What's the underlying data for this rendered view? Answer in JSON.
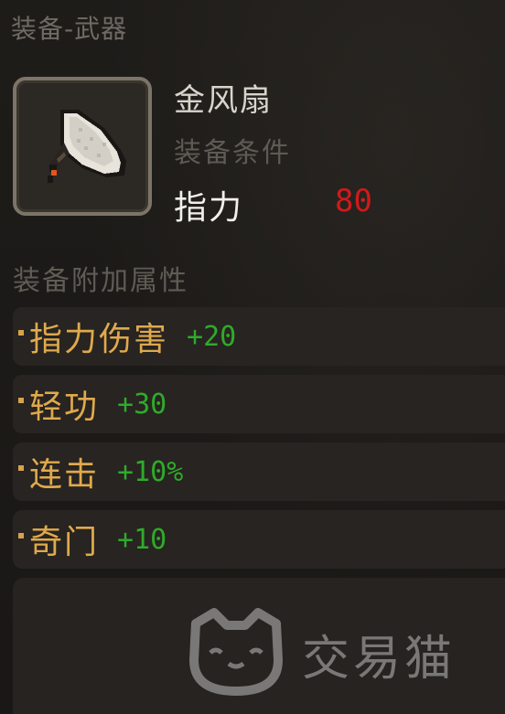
{
  "header": {
    "title": "装备-武器"
  },
  "item": {
    "name": "金风扇",
    "icon": "fan-weapon-icon",
    "requirement_label": "装备条件",
    "requirement_stat": "指力",
    "requirement_value": "80"
  },
  "attributes": {
    "title": "装备附加属性",
    "rows": [
      {
        "name": "指力伤害",
        "value": "+20"
      },
      {
        "name": "轻功",
        "value": "+30"
      },
      {
        "name": "连击",
        "value": "+10%"
      },
      {
        "name": "奇门",
        "value": "+10"
      }
    ]
  },
  "watermark": {
    "text": "交易猫",
    "icon": "cat-logo-icon"
  },
  "colors": {
    "background": "#1b1917",
    "attribute_name": "#e0a94c",
    "attribute_value": "#2faa2a",
    "requirement_value": "#d01a1a"
  }
}
